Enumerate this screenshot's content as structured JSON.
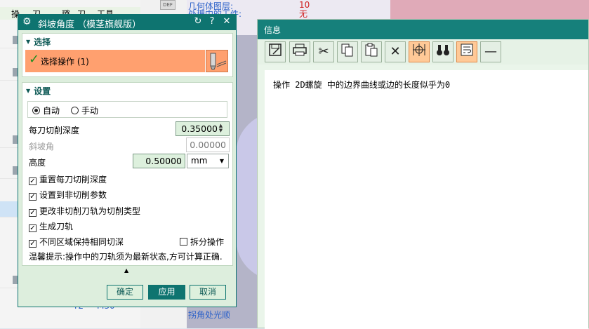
{
  "background": {
    "tabs": [
      "操",
      "刀",
      "璐",
      "刀",
      "工具"
    ],
    "left_bottom": [
      "Y2",
      "M30"
    ],
    "right_texts": [
      {
        "label": "几何体图层:",
        "value": "10"
      },
      {
        "label": "处理中的工件:",
        "value": "无"
      }
    ],
    "right_bottom_text": "拐角处光顺"
  },
  "dialog": {
    "title": "斜坡角度 （模茎旗舰版）",
    "selection": {
      "header": "选择",
      "row_label": "选择操作 (1)"
    },
    "settings": {
      "header": "设置",
      "mode_options": [
        "自动",
        "手动"
      ],
      "mode_selected": "自动",
      "depth_label": "每刀切削深度",
      "depth_value": "0.35000",
      "ramp_label": "斜坡角",
      "ramp_value": "0.00000",
      "height_label": "高度",
      "height_value": "0.50000",
      "unit": "mm",
      "checkboxes": [
        {
          "label": "重置每刀切削深度",
          "checked": true
        },
        {
          "label": "设置到非切削参数",
          "checked": true
        },
        {
          "label": "更改非切削刀轨为切削类型",
          "checked": true
        },
        {
          "label": "生成刀轨",
          "checked": true
        },
        {
          "label": "不同区域保持相同切深",
          "checked": true
        }
      ],
      "split_label": "拆分操作",
      "split_checked": false,
      "tip": "温馨提示:操作中的刀轨须为最新状态,方可计算正确."
    },
    "buttons": {
      "ok": "确定",
      "apply": "应用",
      "cancel": "取消"
    }
  },
  "info": {
    "title": "信息",
    "toolbar_icons": [
      "save-icon",
      "print-icon",
      "scissors-icon",
      "copy-icon",
      "paste-icon",
      "close-x-icon",
      "target-icon",
      "binoculars-icon",
      "wrap-text-icon",
      "minus-icon"
    ],
    "message": "操作 2D螺旋 中的边界曲线或边的长度似乎为0"
  }
}
